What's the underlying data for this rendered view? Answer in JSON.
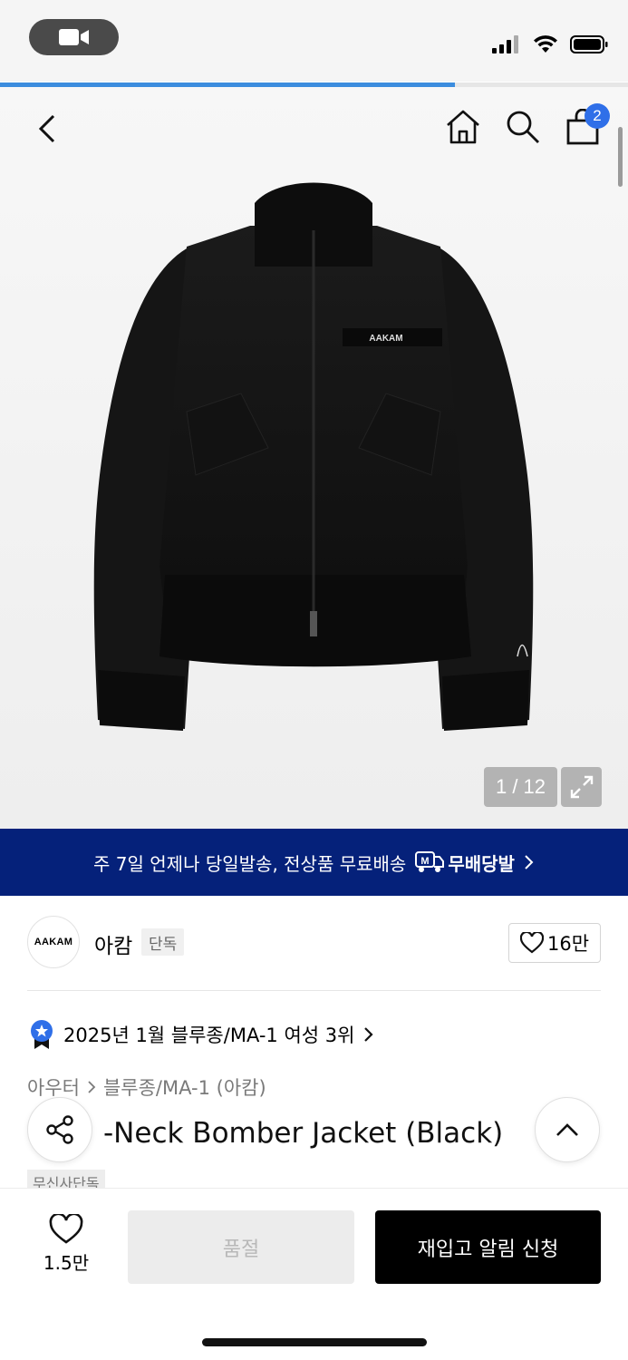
{
  "status_bar": {
    "icons": [
      "video-camera-icon",
      "cellular-signal-icon",
      "wifi-icon",
      "battery-icon"
    ]
  },
  "page_progress": {
    "fraction": 0.725,
    "color": "#3c8dde"
  },
  "nav": {
    "icons": [
      "back-chevron-icon",
      "home-icon",
      "search-icon",
      "shopping-bag-icon"
    ],
    "cart_count": "2",
    "badge_color": "#2f6fe8"
  },
  "product_image": {
    "logo_text": "AAKAM",
    "counter": "1 / 12",
    "expand_icon": "expand-icon"
  },
  "promo": {
    "text": "주 7일 언제나 당일발송, 전상품 무료배송",
    "badge_text": "무배당발",
    "background": "#05217a"
  },
  "brand": {
    "logo_text": "AAKAM",
    "name": "아캄",
    "tag": "단독",
    "like_count": "16만"
  },
  "ranking": {
    "text": "2025년 1월 블루종/MA-1 여성 3위"
  },
  "breadcrumb": {
    "category": "아우터",
    "subcategory": "블루종/MA-1 (아캄)"
  },
  "product": {
    "title": "High-Neck Bomber Jacket (Black)",
    "title_visible": "-Neck Bomber Jacket (Black)",
    "exclusive_tag": "무신사단독"
  },
  "bottom_bar": {
    "wish_count": "1.5만",
    "soldout_label": "품절",
    "restock_label": "재입고 알림 신청"
  }
}
